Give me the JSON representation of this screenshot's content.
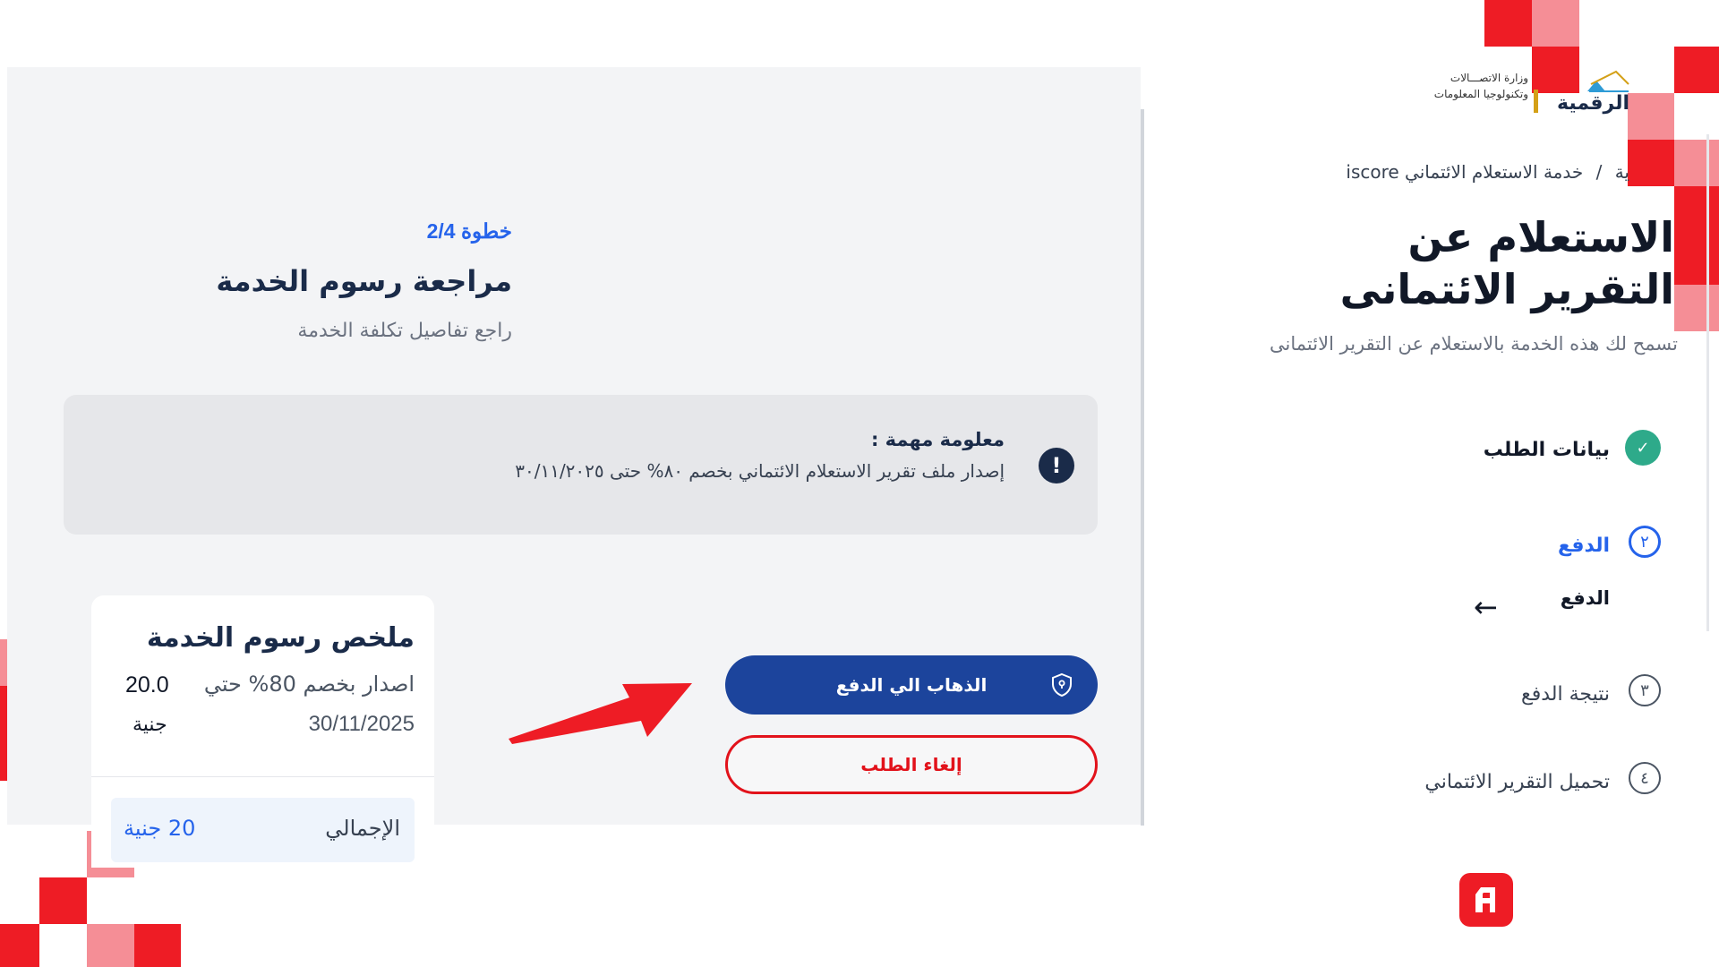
{
  "step_indicator": "خطوة 2/4",
  "section": {
    "title": "مراجعة رسوم الخدمة",
    "subtitle": "راجع تفاصيل تكلفة الخدمة"
  },
  "info_box": {
    "title": "معلومة مهمة :",
    "text": "إصدار ملف تقرير الاستعلام الائتماني بخصم ٨٠% حتى ٣٠/١١/٢٠٢٥",
    "icon": "!"
  },
  "summary": {
    "title": "ملخص رسوم الخدمة",
    "item_desc": "اصدار بخصم 80% حتي",
    "item_date": "30/11/2025",
    "item_amount": "20.0",
    "item_currency": "جنية",
    "total_label": "الإجمالي",
    "total_value": "20 جنية"
  },
  "buttons": {
    "pay": "الذهاب الي الدفع",
    "cancel": "إلغاء الطلب"
  },
  "sidebar": {
    "logo_line1": "وزارة الاتصـــالات",
    "logo_line2": "وتكنولوجيا المعلومات",
    "logo_brand": "الرقمية",
    "breadcrumb_first": "ية",
    "breadcrumb_sep": "/",
    "breadcrumb_current": "خدمة الاستعلام الائتماني iscore",
    "page_title": "الاستعلام عن التقرير الائتمانى",
    "page_desc": "تسمح لك هذه الخدمة بالاستعلام عن التقرير الائتمانى",
    "steps": [
      {
        "number": "✓",
        "label": "بيانات الطلب"
      },
      {
        "number": "٢",
        "label": "الدفع",
        "sub": "الدفع"
      },
      {
        "number": "٣",
        "label": "نتيجة الدفع"
      },
      {
        "number": "٤",
        "label": "تحميل التقرير الائتماني"
      }
    ]
  },
  "colors": {
    "primary": "#1c449c",
    "danger": "#e2121b",
    "accent": "#2563eb",
    "success": "#2eaa8a",
    "brand_red": "#ee1c25"
  }
}
